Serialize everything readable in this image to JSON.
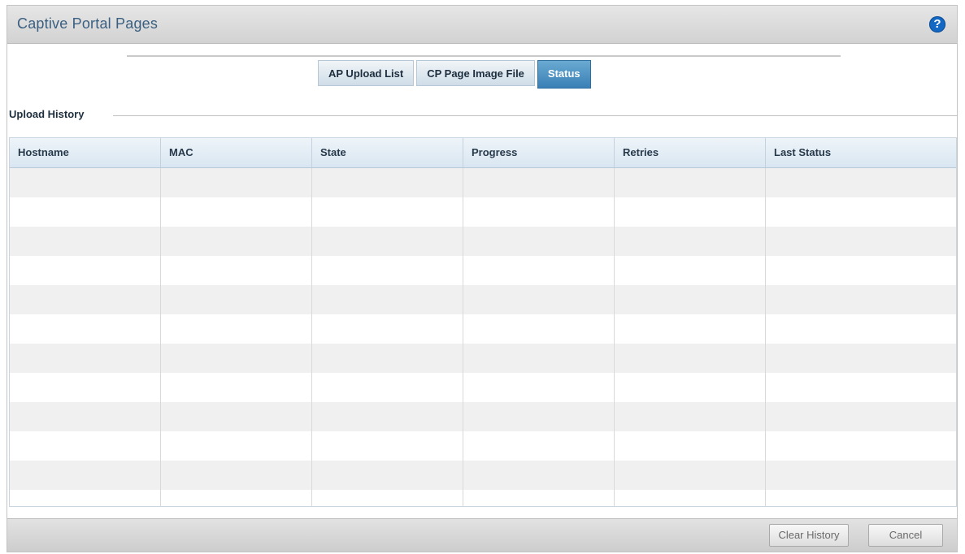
{
  "panel": {
    "title": "Captive Portal Pages",
    "help_icon": "?"
  },
  "tabs": [
    {
      "label": "AP Upload List",
      "active": false
    },
    {
      "label": "CP Page Image File",
      "active": false
    },
    {
      "label": "Status",
      "active": true
    }
  ],
  "upload_history": {
    "label": "Upload History",
    "columns": [
      "Hostname",
      "MAC",
      "State",
      "Progress",
      "Retries",
      "Last Status"
    ],
    "rows": []
  },
  "footer": {
    "clear_label": "Clear History",
    "cancel_label": "Cancel"
  },
  "colors": {
    "title_text": "#3a5f80",
    "active_tab": "#3a80b6",
    "help_icon": "#1368c4"
  }
}
